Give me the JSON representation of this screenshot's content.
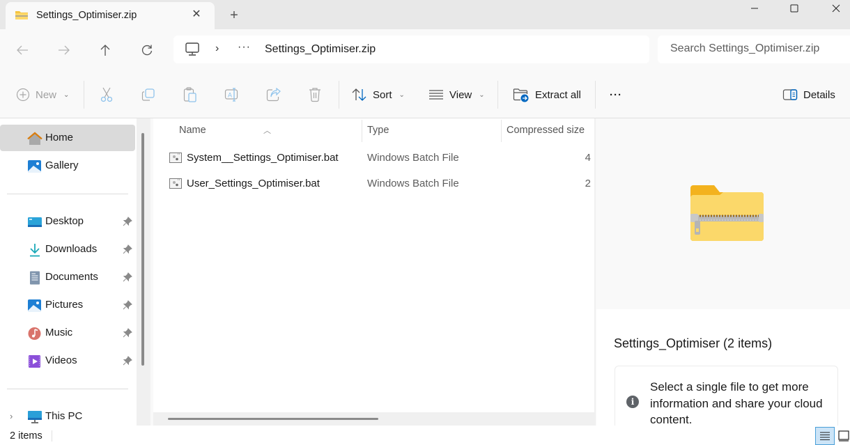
{
  "window": {
    "tab_title": "Settings_Optimiser.zip",
    "tab_icon": "zip-folder-icon",
    "close_tab": "close-tab-icon",
    "new_tab": "+",
    "controls": [
      "minimize-icon",
      "maximize-icon",
      "close-window-icon"
    ]
  },
  "nav": {
    "back": "back-arrow-icon",
    "forward": "forward-arrow-icon",
    "up": "up-arrow-icon",
    "refresh": "refresh-icon",
    "breadcrumb": {
      "root_icon": "this-pc-icon",
      "separator": "›",
      "overflow": "···",
      "current": "Settings_Optimiser.zip"
    },
    "search_placeholder": "Search Settings_Optimiser.zip"
  },
  "toolbar": {
    "new_label": "New",
    "cut": "cut-icon",
    "copy": "copy-icon",
    "paste": "paste-icon",
    "rename": "rename-icon",
    "share": "share-icon",
    "delete": "delete-icon",
    "sort_label": "Sort",
    "view_label": "View",
    "extract_label": "Extract all",
    "more": "···",
    "details_label": "Details"
  },
  "sidebar": {
    "top_items": [
      {
        "label": "Home",
        "icon": "home-icon",
        "selected": true
      },
      {
        "label": "Gallery",
        "icon": "gallery-icon",
        "selected": false
      }
    ],
    "quick_access": [
      {
        "label": "Desktop",
        "icon": "desktop-icon",
        "pinned": true
      },
      {
        "label": "Downloads",
        "icon": "downloads-icon",
        "pinned": true
      },
      {
        "label": "Documents",
        "icon": "documents-icon",
        "pinned": true
      },
      {
        "label": "Pictures",
        "icon": "pictures-icon",
        "pinned": true
      },
      {
        "label": "Music",
        "icon": "music-icon",
        "pinned": true
      },
      {
        "label": "Videos",
        "icon": "videos-icon",
        "pinned": true
      }
    ],
    "this_pc": {
      "label": "This PC",
      "icon": "this-pc-icon",
      "expander": "›"
    }
  },
  "file_list": {
    "columns": [
      "Name",
      "Type",
      "Compressed size"
    ],
    "sort_indicator": "^",
    "rows": [
      {
        "name": "System__Settings_Optimiser.bat",
        "type": "Windows Batch File",
        "size": "4"
      },
      {
        "name": "User_Settings_Optimiser.bat",
        "type": "Windows Batch File",
        "size": "2"
      }
    ]
  },
  "details": {
    "title": "Settings_Optimiser (2 items)",
    "info_text": "Select a single file to get more information and share your cloud content.",
    "info_icon": "i"
  },
  "status": {
    "item_count": "2 items"
  },
  "colors": {
    "accent": "#0067c0",
    "folder_yellow": "#f7c948",
    "selected_bg": "#dadada"
  }
}
